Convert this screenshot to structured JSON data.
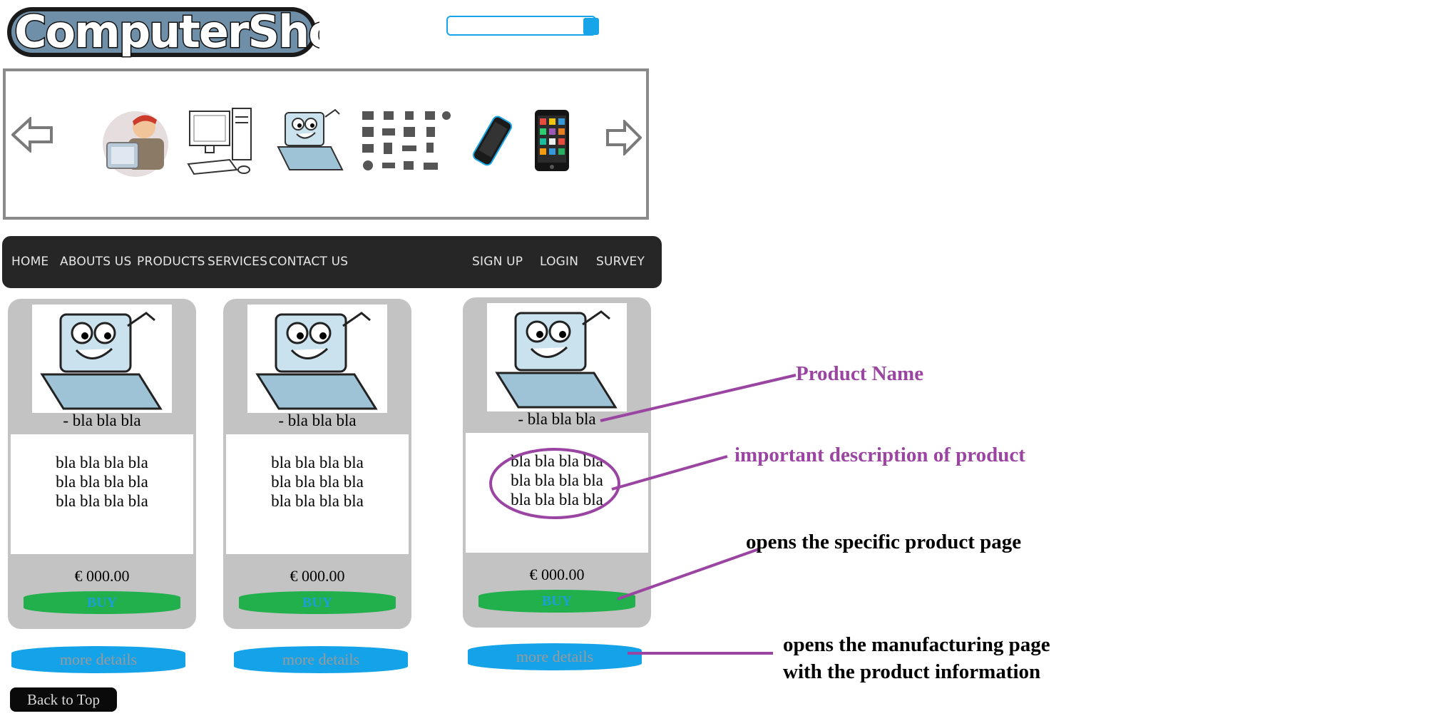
{
  "header": {
    "logo_text": "ComputerShop",
    "search": {
      "placeholder": ""
    }
  },
  "carousel": {
    "prev_icon": "arrow-left-icon",
    "next_icon": "arrow-right-icon",
    "items": [
      "technician-image",
      "desktop-computer-image",
      "laptop-cartoon-image",
      "electronics-icons-image",
      "smartphone-image",
      "tablet-image"
    ]
  },
  "nav": {
    "left": [
      "HOME",
      "ABOUTS US",
      "PRODUCTS",
      "SERVICES",
      "CONTACT US"
    ],
    "right": [
      "SIGN UP",
      "LOGIN",
      "SURVEY"
    ]
  },
  "products": [
    {
      "name": "-  bla bla bla",
      "desc": [
        "bla bla bla bla",
        "bla bla bla bla",
        "bla bla bla bla"
      ],
      "price": "€ 000.00",
      "buy": "BUY",
      "more": "more details"
    },
    {
      "name": "-  bla bla bla",
      "desc": [
        "bla bla bla bla",
        "bla bla bla bla",
        "bla bla bla bla"
      ],
      "price": "€ 000.00",
      "buy": "BUY",
      "more": "more details"
    },
    {
      "name": "-  bla bla bla",
      "desc": [
        "bla bla bla bla",
        "bla bla bla bla",
        "bla bla bla bla"
      ],
      "price": "€ 000.00",
      "buy": "BUY",
      "more": "more details"
    }
  ],
  "back_to_top": "Back to Top",
  "annotations": {
    "product_name": "Product Name",
    "description": "important description of product",
    "buy": "opens the specific product page",
    "more_line1": "opens the manufacturing page",
    "more_line2": "with the product information"
  },
  "colors": {
    "nav_bg": "#262626",
    "card_bg": "#c3c3c3",
    "buy_green": "#22b04c",
    "details_blue": "#14a3e8",
    "annotation_purple": "#9b45a2"
  }
}
